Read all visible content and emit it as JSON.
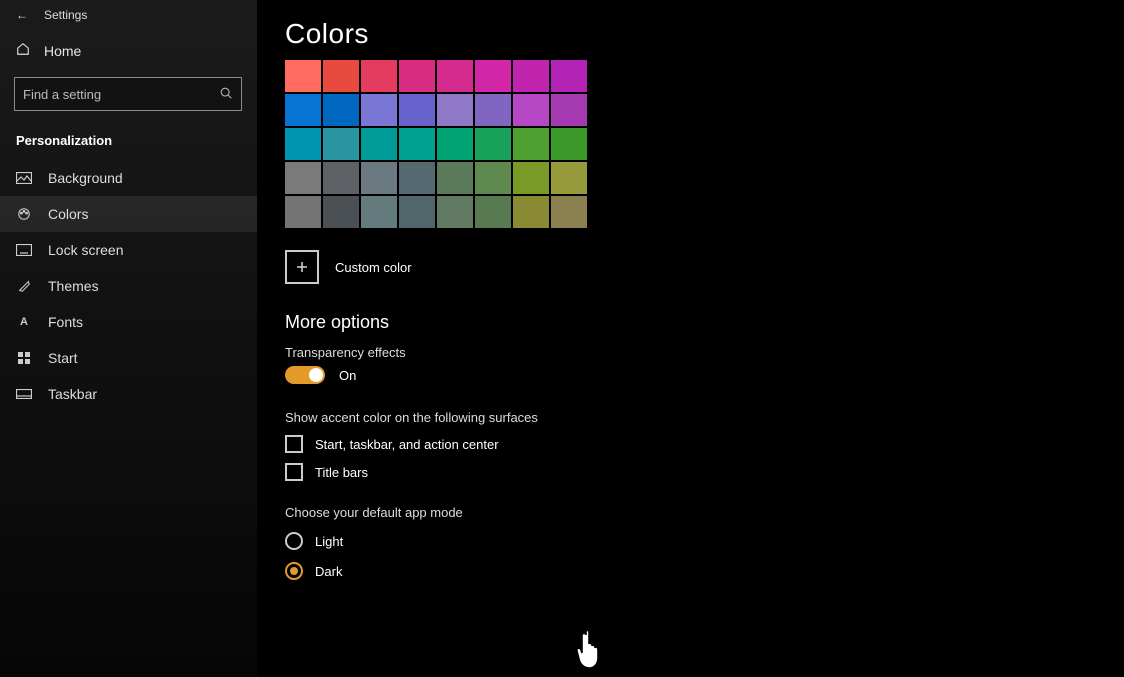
{
  "sidebar": {
    "back_icon": "←",
    "title": "Settings",
    "home_label": "Home",
    "search_placeholder": "Find a setting",
    "section": "Personalization",
    "items": [
      {
        "icon": "background",
        "label": "Background"
      },
      {
        "icon": "colors",
        "label": "Colors",
        "selected": true
      },
      {
        "icon": "lockscreen",
        "label": "Lock screen"
      },
      {
        "icon": "themes",
        "label": "Themes"
      },
      {
        "icon": "fonts",
        "label": "Fonts"
      },
      {
        "icon": "start",
        "label": "Start"
      },
      {
        "icon": "taskbar",
        "label": "Taskbar"
      }
    ]
  },
  "main": {
    "title": "Colors",
    "swatches": [
      [
        "#ff6b60",
        "#e74a3f",
        "#e43c5f",
        "#d82d83",
        "#d52a8e",
        "#d127a7",
        "#c225ad",
        "#b323b6"
      ],
      [
        "#0774d4",
        "#0067c0",
        "#7a76d6",
        "#6762cc",
        "#8f78c7",
        "#8066c0",
        "#b648c6",
        "#a439b1"
      ],
      [
        "#0094b0",
        "#2a94a0",
        "#009a98",
        "#00a08f",
        "#00a272",
        "#18a25a",
        "#4f9f33",
        "#3c9a2a"
      ],
      [
        "#7a7a7a",
        "#5d6165",
        "#6a7a80",
        "#546a70",
        "#5a7a5a",
        "#5f8a4f",
        "#7a9a28",
        "#969a3a"
      ],
      [
        "#747474",
        "#4a5054",
        "#647b7e",
        "#50666a",
        "#617a61",
        "#587a50",
        "#8a8a34",
        "#8a8050"
      ]
    ],
    "custom_color_label": "Custom color",
    "more_options_label": "More options",
    "transparency": {
      "label": "Transparency effects",
      "state_label": "On",
      "on": true
    },
    "accent_surfaces": {
      "label": "Show accent color on the following surfaces",
      "opt1": "Start, taskbar, and action center",
      "opt2": "Title bars"
    },
    "app_mode": {
      "label": "Choose your default app mode",
      "option_light": "Light",
      "option_dark": "Dark",
      "selected": "Dark"
    }
  }
}
